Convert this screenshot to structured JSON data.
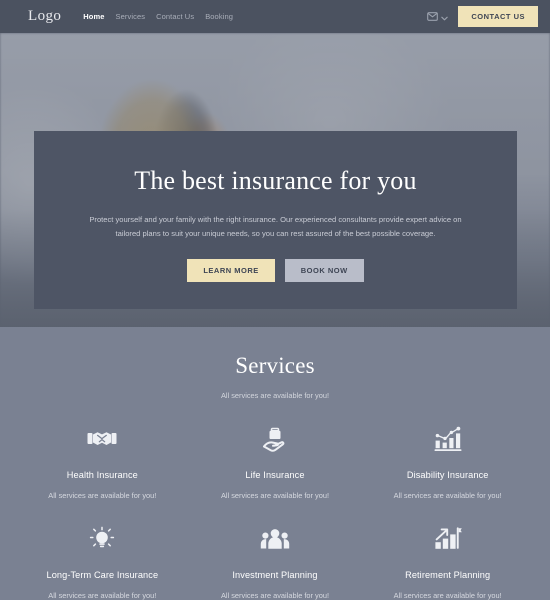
{
  "header": {
    "logo": "Logo",
    "nav": [
      {
        "label": "Home",
        "active": true
      },
      {
        "label": "Services",
        "active": false
      },
      {
        "label": "Contact Us",
        "active": false
      },
      {
        "label": "Booking",
        "active": false
      }
    ],
    "mail_icon": "mail-icon",
    "chevron_icon": "chevron-down-icon",
    "contact_button": "CONTACT US",
    "bg_color": "#4b5260",
    "accent_color": "#f0e3b8"
  },
  "hero": {
    "title": "The best insurance for you",
    "subtitle": "Protect yourself and your family with the right insurance. Our experienced consultants provide expert advice on tailored plans to suit your unique needs, so you can rest assured of the best possible coverage.",
    "primary_button": "LEARN MORE",
    "secondary_button": "BOOK NOW",
    "card_color": "#4e5565"
  },
  "services": {
    "title": "Services",
    "subtitle": "All services are available for you!",
    "bg_color": "#7a8192",
    "items": [
      {
        "name": "Health Insurance",
        "desc": "All services are available for you!",
        "icon": "handshake-icon"
      },
      {
        "name": "Life Insurance",
        "desc": "All services are available for you!",
        "icon": "hand-holding-briefcase-icon"
      },
      {
        "name": "Disability Insurance",
        "desc": "All services are available for you!",
        "icon": "bar-chart-trend-icon"
      },
      {
        "name": "Long-Term Care Insurance",
        "desc": "All services are available for you!",
        "icon": "lightbulb-icon"
      },
      {
        "name": "Investment Planning",
        "desc": "All services are available for you!",
        "icon": "people-group-icon"
      },
      {
        "name": "Retirement Planning",
        "desc": "All services are available for you!",
        "icon": "growth-flag-icon"
      }
    ]
  }
}
